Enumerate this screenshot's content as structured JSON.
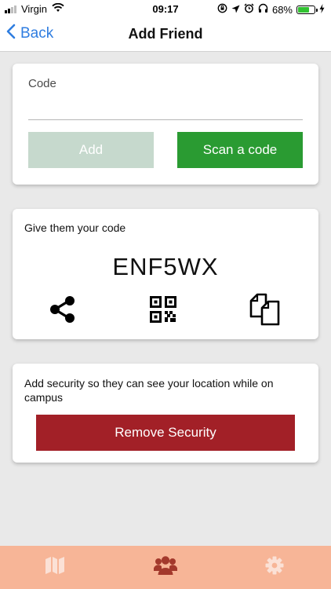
{
  "status_bar": {
    "carrier": "Virgin",
    "time": "09:17",
    "battery_percent": "68%",
    "battery_level": 0.68,
    "icons": [
      "signal-icon",
      "wifi-icon",
      "location-lock-icon",
      "location-arrow-icon",
      "alarm-icon",
      "headphones-icon",
      "battery-icon",
      "charging-icon"
    ]
  },
  "nav": {
    "back_label": "Back",
    "title": "Add Friend"
  },
  "add_code": {
    "label": "Code",
    "input_value": "",
    "add_label": "Add",
    "scan_label": "Scan a code"
  },
  "give_code": {
    "label": "Give them your code",
    "code": "ENF5WX",
    "actions": [
      "share-icon",
      "qr-code-icon",
      "copy-icon"
    ]
  },
  "security": {
    "text": "Add security so they can see your location while on campus",
    "button_label": "Remove Security"
  },
  "tab_bar": {
    "tabs": [
      "map-icon",
      "friends-icon",
      "settings-icon"
    ],
    "active_tab": "friends-icon"
  },
  "colors": {
    "accent_blue": "#2f7de0",
    "scan_green": "#2a9b32",
    "add_disabled": "#c6d9cd",
    "remove_red": "#a22027",
    "tab_bar": "#f7b597",
    "tab_active": "#a3392c",
    "tab_inactive": "#fbe1d6",
    "battery_green": "#31c231"
  }
}
